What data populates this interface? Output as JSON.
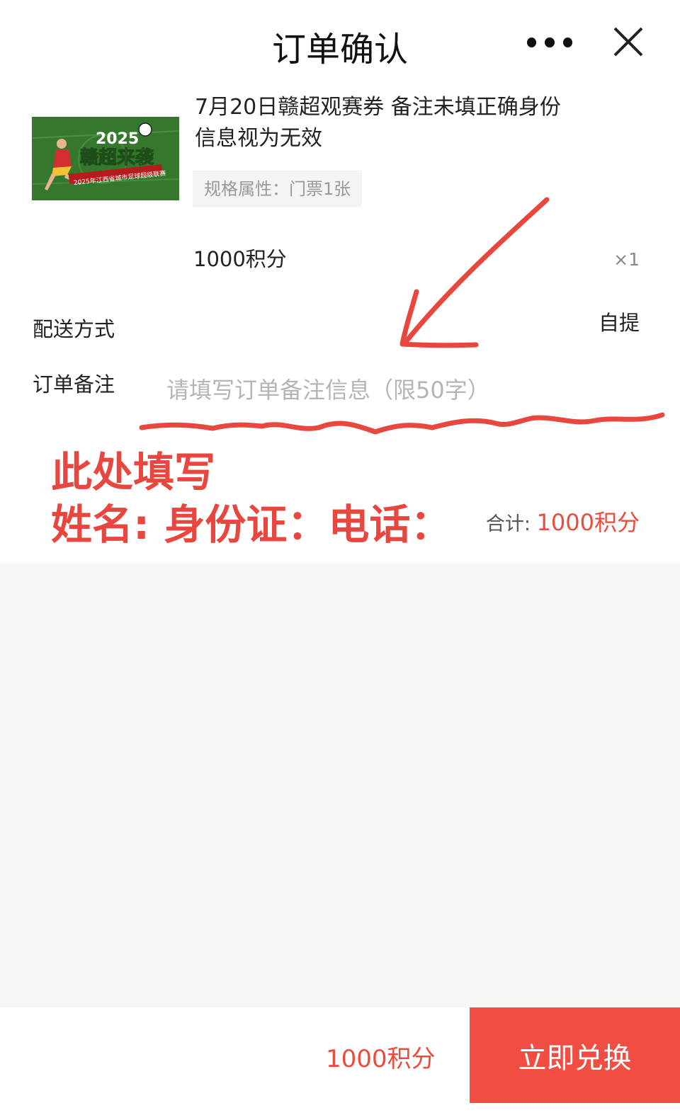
{
  "header": {
    "title": "订单确认",
    "more_icon": "more-dots-icon",
    "close_icon": "close-icon"
  },
  "product": {
    "name": "7月20日赣超观赛券 备注未填正确身份信息视为无效",
    "spec": "规格属性：门票1张",
    "price": "1000积分",
    "quantity": "×1",
    "image": {
      "year": "2025",
      "headline": "赣超来袭",
      "banner": "2025年江西省城市足球超级联赛"
    }
  },
  "delivery": {
    "label": "配送方式",
    "value": "自提"
  },
  "remark": {
    "label": "订单备注",
    "placeholder": "请填写订单备注信息（限50字）",
    "value": ""
  },
  "annotation": {
    "line1": "此处填写",
    "line2": "姓名: 身份证：电话：",
    "color": "#e8473f"
  },
  "total": {
    "label": "合计:",
    "value": "1000积分"
  },
  "footer": {
    "price": "1000积分",
    "submit_label": "立即兑换",
    "accent": "#f04e43"
  }
}
